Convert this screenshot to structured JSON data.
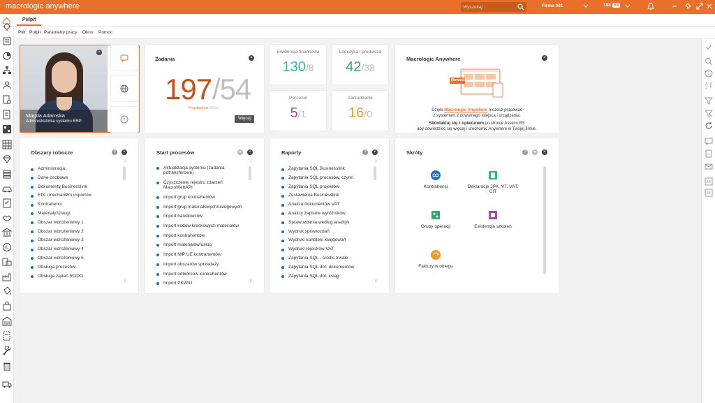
{
  "app": {
    "brand": "macrologic anywhere"
  },
  "search": {
    "placeholder": "Wyszukaj..."
  },
  "company": {
    "label": "Firma 001"
  },
  "task_counter": {
    "total": "198",
    "badge": "54"
  },
  "tabs": [
    {
      "label": "Pulpit"
    }
  ],
  "menu": [
    "Plik",
    "Pulpit",
    "Parametry pracy",
    "Okno",
    "Pomoc"
  ],
  "user": {
    "name": "Magda Adamska",
    "role": "Administratorka systemu ERP"
  },
  "zadania": {
    "title": "Zadania",
    "assigned": "197",
    "total": "54",
    "caption_assigned": "Przydzielone",
    "caption_total": "Wolne",
    "more_button": "Więcej"
  },
  "stats": [
    {
      "label": "Ewidencja finansowa",
      "value": "130",
      "total": "8",
      "color": "#3ab5b5"
    },
    {
      "label": "Logistyka i produkcja",
      "value": "42",
      "total": "38",
      "color": "#3aa56a"
    },
    {
      "label": "Personel",
      "value": "5",
      "total": "1",
      "color": "#a24aa3"
    },
    {
      "label": "Zarządzanie",
      "value": "16",
      "total": "0",
      "color": "#f0982b"
    }
  ],
  "promo": {
    "title": "Macrologic Anywhere",
    "badge": "Nowość",
    "line1_pre": "Dzięki ",
    "line1_link": "Macrologic Anywhere",
    "line1_post": " możesz pracować",
    "line2": "z systemem z dowolnego miejsca i urządzenia.",
    "line3_bold": "Skontaktuj się z opiekunem",
    "line3_post": " po stronie Asseco BS",
    "line4": "aby dowiedzieć się więcej i uruchomić Anywhere w Twojej firmie."
  },
  "obszary": {
    "title": "Obszary robocze",
    "items": [
      "Administracja",
      "Dane osobowe",
      "Dokumenty Businesslink",
      "EDI i mechanizm importów",
      "Kontrahenci",
      "Materiały/Usługi",
      "Obszar wdrożeniowy 1",
      "Obszar wdrożeniowy 2",
      "Obszar wdrożeniowy 3",
      "Obszar wdrożeniowy 4",
      "Obszar wdrożeniowy 5",
      "Obsługa procesów",
      "Obsługa żądań RODO"
    ]
  },
  "start": {
    "title": "Start procesów",
    "items": [
      "Aktualizacja systemu (zadania potransferowe)",
      "Czyszczenie rejestru zdarzeń MacroWebAPI",
      "Import grup kontrahentów",
      "Import grup materiałowych/usługowych",
      "Import handlowców",
      "Import kodów kreskowych materiałów",
      "Import kontrahentów",
      "Import materiałów/usług",
      "Import NIP UE kontrahentów",
      "Import obszarów sprzedaży",
      "Import odbiorców kontrahentów",
      "Import PKWiU"
    ]
  },
  "raporty": {
    "title": "Raporty",
    "items": [
      "Zapytania SQL Businesslink",
      "Zapytania SQL procesów, czynn.",
      "Zapytania SQL projektów",
      "Zestawienia Businesslink",
      "Analiza dokumentów VAT",
      "Analizy zapisów wyróżników",
      "Sprawozdania według analityk",
      "Wydruk sprawozdań",
      "Wydruki kartoteki księgowań",
      "Wydruki rejestrów VAT",
      "Zapytania SQL - środki trwałe",
      "Zapytania SQL dot. dokumentów",
      "Zapytania SQL dot. ksiąg"
    ]
  },
  "skroty": {
    "title": "Skróty",
    "items": [
      "Kontrahenci",
      "Deklaracje JPK_V7, VAT, CIT",
      "Grupy operacji",
      "Ewidencja szkoleń",
      "Faktury w obiegu"
    ]
  },
  "colors": {
    "accent": "#e8702a",
    "bullet": "#1e6fb8",
    "big_number": "#c4501a"
  },
  "icons": {
    "top": [
      "search-icon",
      "chevron-down-icon",
      "bell-icon",
      "minimize-icon",
      "pin-icon",
      "expand-icon",
      "close-icon"
    ],
    "left": [
      "lightbulb-icon",
      "calculator-icon",
      "chart-icon",
      "hierarchy-icon",
      "people-icon",
      "settings-doc-icon",
      "document-icon",
      "grid-doc-icon",
      "table-icon",
      "diamond-icon",
      "stack-icon",
      "car-icon",
      "checklist-icon",
      "handshake-icon",
      "bank-icon",
      "euro-icon",
      "factory-doc-icon",
      "factory-icon",
      "paint-bucket-icon",
      "shopping-bag-icon",
      "building-icon",
      "document-list-icon",
      "wrench-icon",
      "trash-icon",
      "truck-icon"
    ],
    "right": [
      "check-icon",
      "magnifier-icon",
      "info-icon",
      "sort-az-icon",
      "filter-icon",
      "filter-clear-icon",
      "refresh-icon",
      "comments-icon",
      "export-icon",
      "mail-icon",
      "ab-icon",
      "ab-box-icon"
    ]
  }
}
